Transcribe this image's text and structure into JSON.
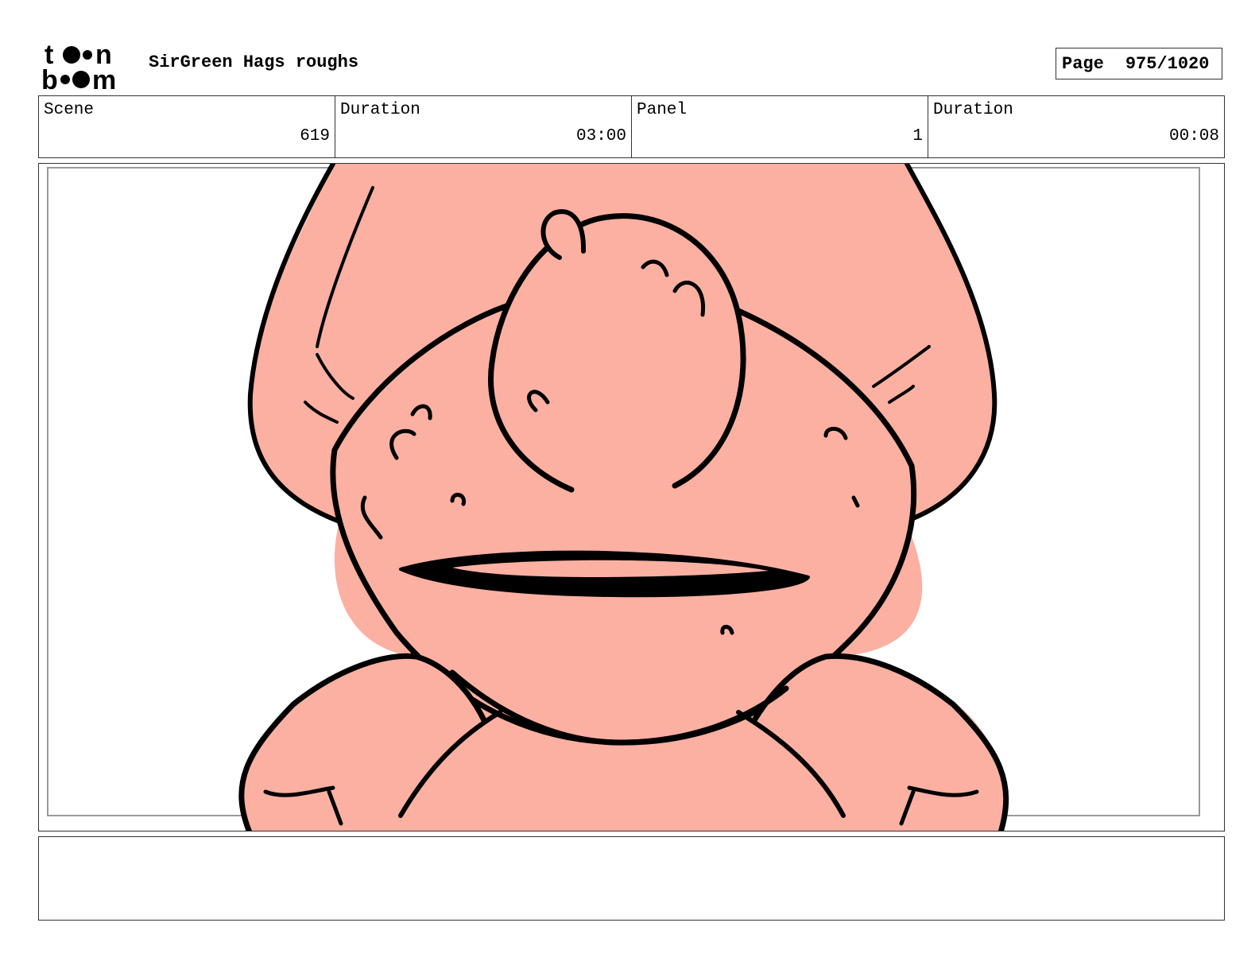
{
  "header": {
    "logo_text": "toon boom",
    "project_title": "SirGreen Hags roughs",
    "page_label": "Page",
    "page_number": "975/1020"
  },
  "info": {
    "scene_label": "Scene",
    "scene_value": "619",
    "scene_duration_label": "Duration",
    "scene_duration_value": "03:00",
    "panel_label": "Panel",
    "panel_value": "1",
    "panel_duration_label": "Duration",
    "panel_duration_value": "00:08"
  },
  "panel": {
    "skin_color": "#fbb0a2",
    "line_color": "#000000"
  },
  "notes": {
    "text": ""
  }
}
